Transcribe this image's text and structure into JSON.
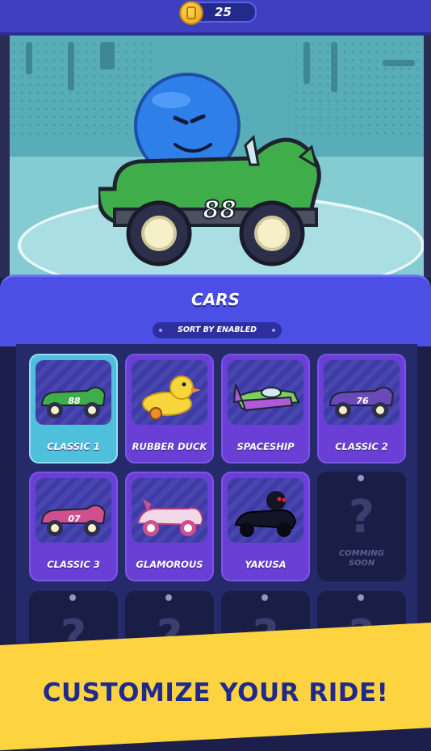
{
  "currency": {
    "coins": "25",
    "icon": "coin-icon"
  },
  "garage": {
    "car_number": "88"
  },
  "cars_panel": {
    "title": "CARS",
    "sort_label": "SORT BY ENABLED"
  },
  "cars": [
    {
      "label": "CLASSIC 1",
      "number": "88",
      "body_color": "#3fae4a",
      "selected": true
    },
    {
      "label": "RUBBER DUCK",
      "number": "",
      "body_color": "#f6d63a",
      "selected": false
    },
    {
      "label": "SPACESHIP",
      "number": "",
      "body_color": "#7ad25a",
      "selected": false
    },
    {
      "label": "CLASSIC 2",
      "number": "76",
      "body_color": "#6a4ab8",
      "selected": false
    },
    {
      "label": "CLASSIC 3",
      "number": "07",
      "body_color": "#d0508e",
      "selected": false
    },
    {
      "label": "GLAMOROUS",
      "number": "",
      "body_color": "#f0d8e8",
      "selected": false
    },
    {
      "label": "YAKUSA",
      "number": "",
      "body_color": "#141426",
      "selected": false
    }
  ],
  "locked_slot": {
    "label_line1": "COMMING",
    "label_line2": "SOON",
    "icon": "question-mark-icon"
  },
  "banner": {
    "text": "CUSTOMIZE YOUR RIDE!"
  },
  "colors": {
    "accent": "#4c4fe6",
    "card": "#6a3fd6",
    "selected_card": "#4fc0dc",
    "banner": "#fdd43f",
    "banner_text": "#1f2a8c"
  }
}
